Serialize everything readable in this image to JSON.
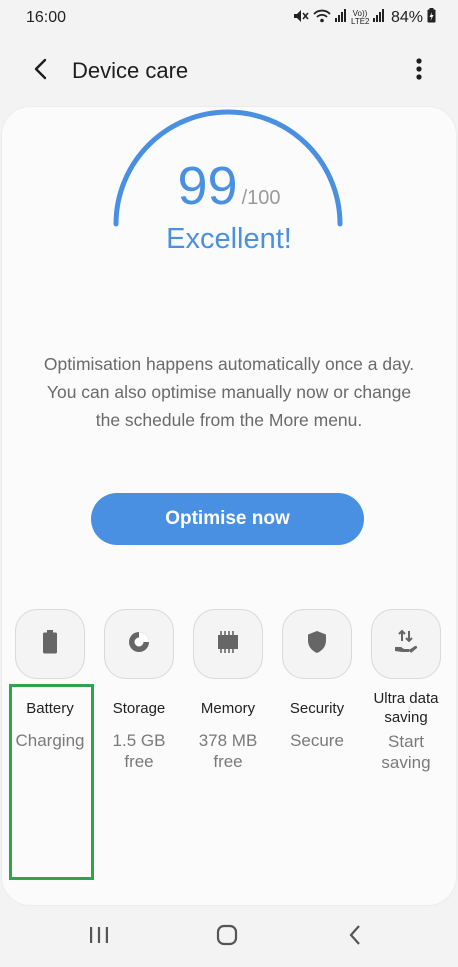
{
  "status_bar": {
    "time": "16:00",
    "battery_percent": "84%",
    "icons": [
      "mute-icon",
      "wifi-icon",
      "signal-icon",
      "volte-icon",
      "signal-icon",
      "battery-charging-icon"
    ],
    "volte_label": "Vo)) LTE2"
  },
  "app_bar": {
    "title": "Device care",
    "back_icon": "back-arrow-icon",
    "more_icon": "more-vertical-icon"
  },
  "score": {
    "value": "99",
    "max": "/100",
    "fraction": 0.99,
    "status": "Excellent!"
  },
  "description": "Optimisation happens automatically once a day. You can also optimise manually now or change the schedule from the More menu.",
  "optimise_button": "Optimise now",
  "tiles": [
    {
      "label": "Battery",
      "value": "Charging",
      "icon": "battery-icon"
    },
    {
      "label": "Storage",
      "value": "1.5 GB free",
      "icon": "storage-pie-icon"
    },
    {
      "label": "Memory",
      "value": "378 MB free",
      "icon": "memory-chip-icon"
    },
    {
      "label": "Security",
      "value": "Secure",
      "icon": "shield-icon"
    },
    {
      "label": "Ultra data saving",
      "value": "Start saving",
      "icon": "data-saving-icon"
    }
  ],
  "nav_bar": {
    "recents_icon": "recents-icon",
    "home_icon": "home-icon",
    "back_icon": "back-chevron-icon"
  },
  "colors": {
    "accent": "#4a90e2",
    "highlight": "#2ea44f",
    "background": "#f3f3f3",
    "card": "#fbfbfb"
  }
}
